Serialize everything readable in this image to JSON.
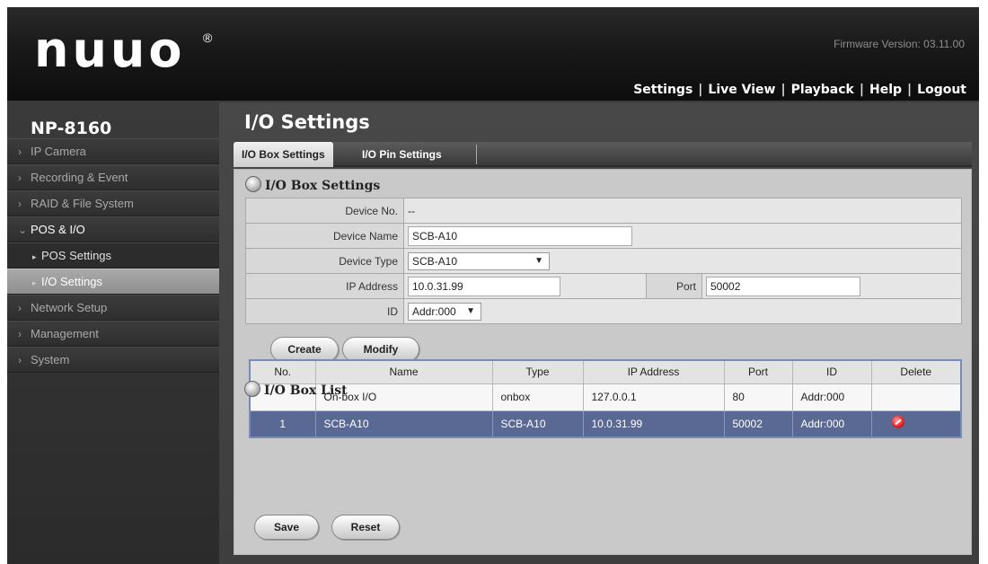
{
  "header": {
    "logo": "nuuo",
    "reg": "®",
    "firmware": "Firmware Version: 03.11.00",
    "nav": [
      "Settings",
      "Live View",
      "Playback",
      "Help",
      "Logout"
    ],
    "sep": "|"
  },
  "sidebar": {
    "model": "NP-8160",
    "items": [
      {
        "label": "IP Camera"
      },
      {
        "label": "Recording & Event"
      },
      {
        "label": "RAID & File System"
      },
      {
        "label": "POS & I/O"
      },
      {
        "label": "POS Settings"
      },
      {
        "label": "I/O Settings"
      },
      {
        "label": "Network Setup"
      },
      {
        "label": "Management"
      },
      {
        "label": "System"
      }
    ]
  },
  "main": {
    "title": "I/O Settings",
    "tabs": [
      "I/O Box Settings",
      "I/O Pin Settings"
    ],
    "box_settings": {
      "title": "I/O Box Settings",
      "device_no_label": "Device No.",
      "device_no_value": "--",
      "device_name_label": "Device Name",
      "device_name_value": "SCB-A10",
      "device_type_label": "Device Type",
      "device_type_value": "SCB-A10",
      "ip_label": "IP Address",
      "ip_value": "10.0.31.99",
      "port_label": "Port",
      "port_value": "50002",
      "id_label": "ID",
      "id_value": "Addr:000",
      "create_label": "Create",
      "modify_label": "Modify"
    },
    "box_list": {
      "title": "I/O Box List",
      "columns": [
        "No.",
        "Name",
        "Type",
        "IP Address",
        "Port",
        "ID",
        "Delete"
      ],
      "rows": [
        {
          "no": "",
          "name": "On-box I/O",
          "type": "onbox",
          "ip": "127.0.0.1",
          "port": "80",
          "id": "Addr:000",
          "delete": false
        },
        {
          "no": "1",
          "name": "SCB-A10",
          "type": "SCB-A10",
          "ip": "10.0.31.99",
          "port": "50002",
          "id": "Addr:000",
          "delete": true
        }
      ]
    },
    "save_label": "Save",
    "reset_label": "Reset"
  },
  "colors": {
    "selected_row": "#5a6993",
    "panel": "#c9c9c9",
    "active_menu": "#a0a0a0"
  },
  "icons": {
    "section": "settings-gear-icon",
    "delete": "delete-icon",
    "chevron": "chevron-right-icon"
  }
}
